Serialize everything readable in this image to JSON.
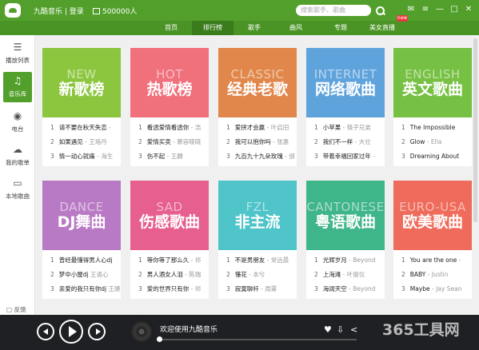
{
  "topbar": {
    "app_title": "九酷音乐 | 登录",
    "coins": "500000人",
    "search_placeholder": "搜索歌手、歌曲",
    "win_buttons": [
      "✉",
      "≡",
      "—",
      "□",
      "✕"
    ]
  },
  "nav": {
    "tabs": [
      "首页",
      "排行榜",
      "歌手",
      "曲风",
      "专题",
      "美女直播"
    ],
    "active_index": 1,
    "badge": "new"
  },
  "sidebar": {
    "items": [
      {
        "label": "播放列表",
        "icon": "☰"
      },
      {
        "label": "音乐库",
        "icon": "♫"
      },
      {
        "label": "电台",
        "icon": "◉"
      },
      {
        "label": "我的歌单",
        "icon": "☁"
      },
      {
        "label": "本地歌曲",
        "icon": "▭"
      }
    ],
    "active_index": 1,
    "feedback": "反馈"
  },
  "cards": [
    {
      "en": "NEW",
      "cn": "新歌榜",
      "color": "#8cc63f",
      "rows": [
        {
          "n": "1",
          "t": "请不要在秋天失恋",
          "a": " -"
        },
        {
          "n": "2",
          "t": "如果遇见",
          "a": " - 王珞丹"
        },
        {
          "n": "3",
          "t": "情一动心就痛",
          "a": " - 海生"
        }
      ]
    },
    {
      "en": "HOT",
      "cn": "热歌榜",
      "color": "#f0707c",
      "rows": [
        {
          "n": "1",
          "t": "看透爱情看透你",
          "a": " - 浩"
        },
        {
          "n": "2",
          "t": "爱情买卖",
          "a": " - 慕容晓晓"
        },
        {
          "n": "3",
          "t": "伤不起",
          "a": " - 王麟"
        }
      ]
    },
    {
      "en": "CLASSIC",
      "cn": "经典老歌",
      "color": "#e1874b",
      "rows": [
        {
          "n": "1",
          "t": "爱拼才会赢",
          "a": " - 叶启田"
        },
        {
          "n": "2",
          "t": "我可以抱你吗",
          "a": " - 张惠"
        },
        {
          "n": "3",
          "t": "九百九十九朵玫瑰",
          "a": " - 邰"
        }
      ]
    },
    {
      "en": "INTERNET",
      "cn": "网络歌曲",
      "color": "#5fa3dc",
      "rows": [
        {
          "n": "1",
          "t": "小苹果",
          "a": " - 筷子兄弟"
        },
        {
          "n": "2",
          "t": "我们不一样",
          "a": " - 大壮"
        },
        {
          "n": "3",
          "t": "带着幸福回家过年",
          "a": " -"
        }
      ]
    },
    {
      "en": "ENGLISH",
      "cn": "英文歌曲",
      "color": "#76c043",
      "rows": [
        {
          "n": "1",
          "t": "The Impossible",
          "a": ""
        },
        {
          "n": "2",
          "t": "Glow",
          "a": " - Ella"
        },
        {
          "n": "3",
          "t": "Dreaming About",
          "a": ""
        }
      ]
    },
    {
      "en": "DANCE",
      "cn": "DJ舞曲",
      "color": "#b97ac5",
      "rows": [
        {
          "n": "1",
          "t": "曾经最懂得男人心dj",
          "a": ""
        },
        {
          "n": "2",
          "t": "梦中小屋dj",
          "a": " 王语心"
        },
        {
          "n": "3",
          "t": "亲爱的我只有你dj",
          "a": " 王婕"
        }
      ]
    },
    {
      "en": "SAD",
      "cn": "伤感歌曲",
      "color": "#e65f8e",
      "rows": [
        {
          "n": "1",
          "t": "等你等了那么久",
          "a": " - 祁"
        },
        {
          "n": "2",
          "t": "男人酒女人泪",
          "a": " - 陈瑞"
        },
        {
          "n": "3",
          "t": "爱的世界只有你",
          "a": " - 祁"
        }
      ]
    },
    {
      "en": "FZL",
      "cn": "非主流",
      "color": "#4fc4c9",
      "rows": [
        {
          "n": "1",
          "t": "不是男朋友",
          "a": " - 常远晨"
        },
        {
          "n": "2",
          "t": "懂花",
          "a": " - 本兮"
        },
        {
          "n": "3",
          "t": "寂寞聊杆",
          "a": " - 周雾"
        }
      ]
    },
    {
      "en": "CANTONESE",
      "cn": "粤语歌曲",
      "color": "#3fb58a",
      "rows": [
        {
          "n": "1",
          "t": "光辉岁月",
          "a": " - Beyond"
        },
        {
          "n": "2",
          "t": "上海滩",
          "a": " - 叶丽仪"
        },
        {
          "n": "3",
          "t": "海阔天空",
          "a": " - Beyond"
        }
      ]
    },
    {
      "en": "EURO-USA",
      "cn": "欧美歌曲",
      "color": "#ef6b5b",
      "rows": [
        {
          "n": "1",
          "t": "You are the one",
          "a": " -"
        },
        {
          "n": "2",
          "t": "BABY",
          "a": " - Justin"
        },
        {
          "n": "3",
          "t": "Maybe",
          "a": " - Jay Sean"
        }
      ]
    }
  ],
  "player": {
    "now_playing": "欢迎使用九酷音乐",
    "progress": 0.0,
    "controls": [
      "♥",
      "⇩",
      "<"
    ]
  },
  "watermark": "365工具网"
}
